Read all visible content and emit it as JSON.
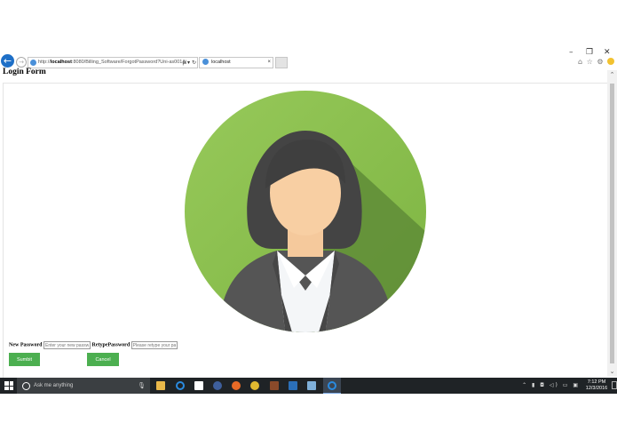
{
  "window": {
    "minimize_glyph": "–",
    "restore_glyph": "❐",
    "close_glyph": "✕"
  },
  "browser": {
    "back_glyph": "←",
    "forward_glyph": "→",
    "address": {
      "prefix": "http://",
      "host": "localhost",
      "rest": ":8080/Billing_Software/ForgotPassword?Uni-as001&j",
      "tools": "ρ ▾ ↻"
    },
    "tab": {
      "title": "localhost",
      "close_glyph": "×"
    },
    "toolbar_icons": "⌂ ☆ ⚙"
  },
  "page": {
    "title": "Login Form",
    "form": {
      "new_password_label": "New Password",
      "new_password_placeholder": "Enter your new password",
      "retype_password_label": "RetypePassword",
      "retype_password_placeholder": "Please retype your password",
      "submit_label": "Sumbit",
      "cancel_label": "Cancel"
    }
  },
  "scrollbar": {
    "up_glyph": "⌃",
    "down_glyph": "⌄"
  },
  "taskbar": {
    "search_placeholder": "Ask me anything",
    "mic_glyph": "🎙",
    "tray_icons": "⌃ ▮ ◘ ◁) ▭ ▣",
    "time": "7:12 PM",
    "date": "12/3/2016"
  },
  "colors": {
    "avatar_bg": "#8bc34a",
    "avatar_shadow": "#5d8a35",
    "button": "#4caf50",
    "taskbar": "#1f2326",
    "ie_blue": "#1e6fc7"
  }
}
